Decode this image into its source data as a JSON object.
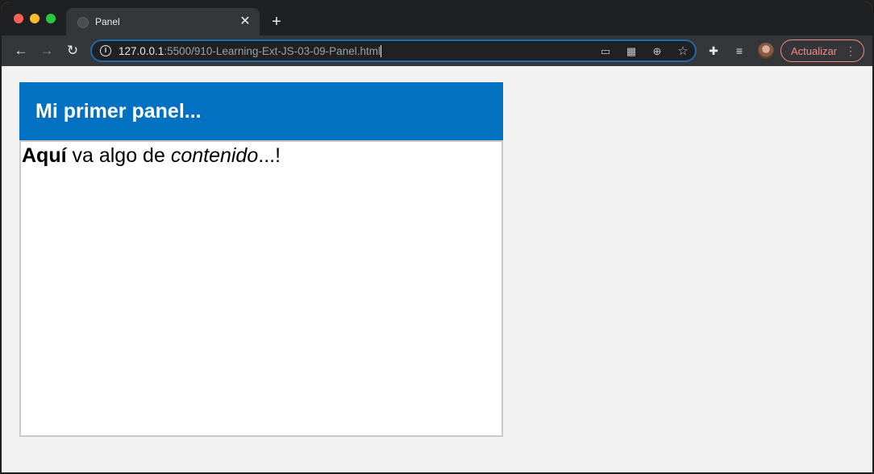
{
  "browser": {
    "tab": {
      "title": "Panel"
    },
    "address": {
      "host": "127.0.0.1",
      "path": ":5500/910-Learning-Ext-JS-03-09-Panel.html"
    },
    "update_button": {
      "label": "Actualizar"
    },
    "icons": {
      "back": "arrow-left-icon",
      "forward": "arrow-right-icon",
      "reload": "reload-icon",
      "info": "info-icon",
      "cast": "cast-icon",
      "qr": "qr-code-icon",
      "zoom": "zoom-icon",
      "bookmark": "star-icon",
      "extensions": "puzzle-icon",
      "media": "media-queue-icon",
      "menu": "kebab-menu-icon"
    },
    "colors": {
      "accent_update": "#f28b82",
      "omnibox_focus": "#1f6aa8"
    }
  },
  "page": {
    "panel": {
      "title": "Mi primer panel...",
      "body": {
        "bold": "Aquí",
        "text1": " va algo de ",
        "italic": "contenido",
        "text2": "...!"
      },
      "colors": {
        "header": "#0271c2",
        "border": "#c9c9c9"
      }
    }
  }
}
